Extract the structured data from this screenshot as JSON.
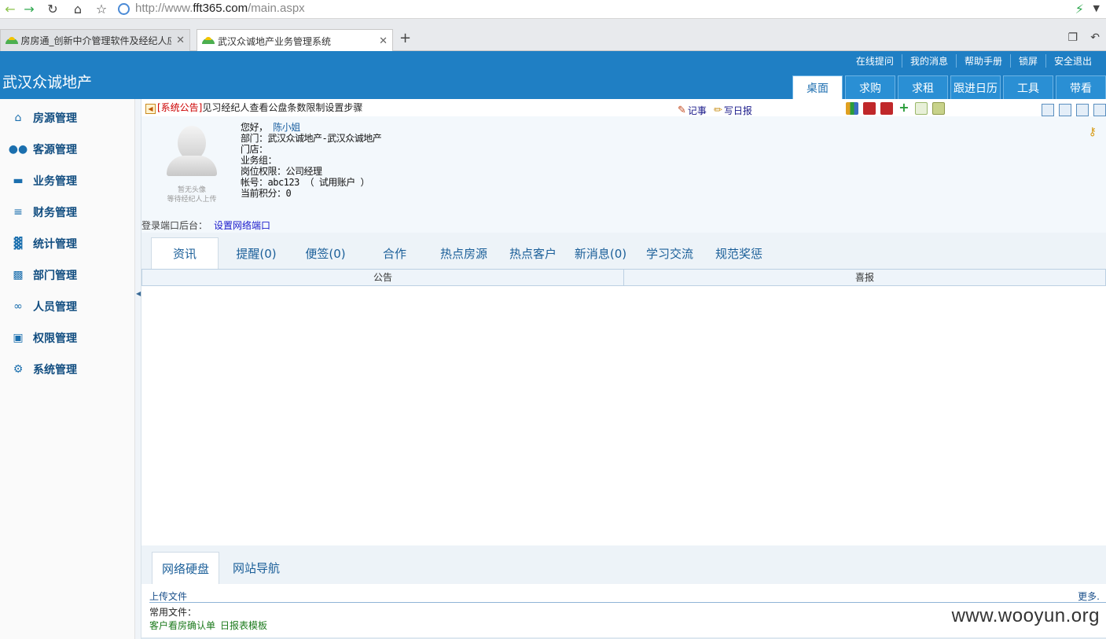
{
  "browser": {
    "url_prefix": "http://www.",
    "url_domain": "fft365.com",
    "url_path": "/main.aspx",
    "tabs": [
      {
        "title": "房房通_创新中介管理软件及经纪人应"
      },
      {
        "title": "武汉众诚地产业务管理系统"
      }
    ]
  },
  "app": {
    "brand": "武汉众诚地产",
    "top_links": [
      "在线提问",
      "我的消息",
      "帮助手册",
      "锁屏",
      "安全退出"
    ],
    "nav_tabs": [
      "桌面",
      "求购",
      "求租",
      "跟进日历",
      "工具",
      "带看"
    ]
  },
  "sidebar": {
    "items": [
      {
        "label": "房源管理",
        "icon": "home-icon"
      },
      {
        "label": "客源管理",
        "icon": "users-icon"
      },
      {
        "label": "业务管理",
        "icon": "car-icon"
      },
      {
        "label": "财务管理",
        "icon": "money-icon"
      },
      {
        "label": "统计管理",
        "icon": "bar-chart-icon"
      },
      {
        "label": "部门管理",
        "icon": "sitemap-icon"
      },
      {
        "label": "人员管理",
        "icon": "paperclip-icon"
      },
      {
        "label": "权限管理",
        "icon": "comments-icon"
      },
      {
        "label": "系统管理",
        "icon": "gear-icon"
      }
    ]
  },
  "notice": {
    "tag": "[系统公告]",
    "text": "见习经纪人查看公盘条数限制设置步骤",
    "note_label": "记事",
    "report_label": "写日报"
  },
  "profile": {
    "avatar_caption1": "暂无头像",
    "avatar_caption2": "等待经纪人上传",
    "greeting": "您好，",
    "user_name": "陈小姐",
    "dept": "部门：武汉众诚地产-武汉众诚地产",
    "store": "门店：",
    "group": "业务组：",
    "role": "岗位权限：公司经理",
    "account": "帐号：abc123 （ 试用账户 ）",
    "points": "当前积分：0",
    "login_label": "登录端口后台：",
    "login_link": "设置网络端口"
  },
  "content_tabs": [
    "资讯",
    "提醒(0)",
    "便签(0)",
    "合作",
    "热点房源",
    "热点客户",
    "新消息(0)",
    "学习交流",
    "规范奖惩"
  ],
  "columns": [
    "公告",
    "喜报"
  ],
  "bottom": {
    "tabs": [
      "网络硬盘",
      "网站导航"
    ],
    "upload": "上传文件",
    "more": "更多.",
    "common_label": "常用文件：",
    "files": [
      "客户看房确认单",
      "日报表模板"
    ]
  },
  "watermark": "www.wooyun.org"
}
